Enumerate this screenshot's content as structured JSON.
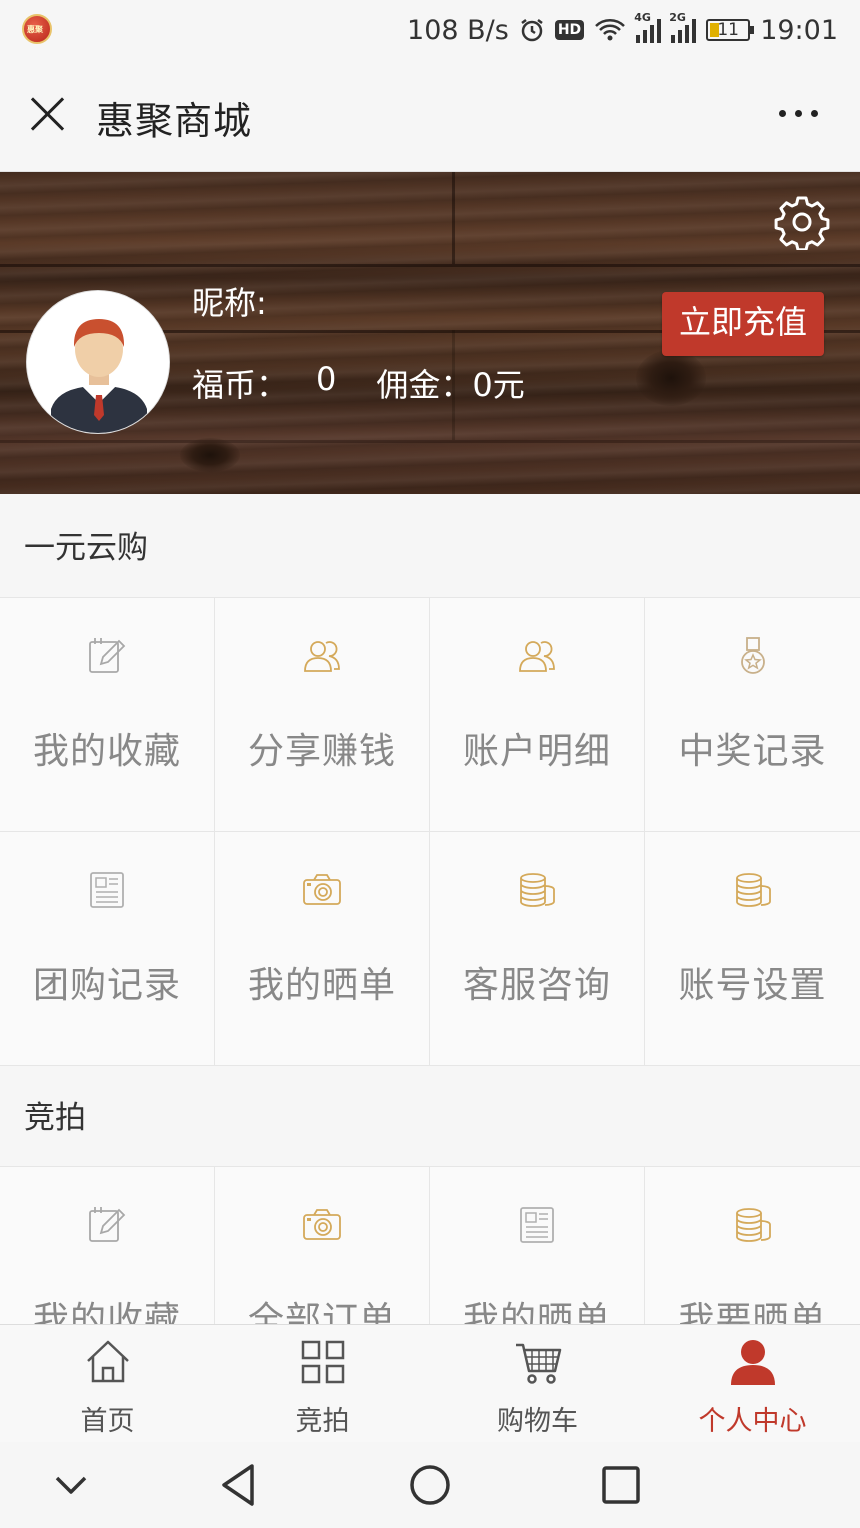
{
  "status_bar": {
    "net_speed": "108 B/s",
    "hd": "HD",
    "signal1": "4G",
    "signal2": "2G",
    "battery": "11",
    "time": "19:01"
  },
  "titlebar": {
    "title": "惠聚商城"
  },
  "profile": {
    "nickname_label": "昵称:",
    "coin_label": "福币：",
    "coin_value": "0",
    "commission_label": "佣金：",
    "commission_value": "0元",
    "recharge_label": "立即充值"
  },
  "sections": [
    {
      "title": "一元云购",
      "items": [
        {
          "label": "我的收藏",
          "icon": "edit-icon"
        },
        {
          "label": "分享赚钱",
          "icon": "users-icon"
        },
        {
          "label": "账户明细",
          "icon": "users-icon"
        },
        {
          "label": "中奖记录",
          "icon": "medal-icon"
        },
        {
          "label": "团购记录",
          "icon": "newspaper-icon"
        },
        {
          "label": "我的晒单",
          "icon": "camera-icon"
        },
        {
          "label": "客服咨询",
          "icon": "coins-icon"
        },
        {
          "label": "账号设置",
          "icon": "coins-icon"
        }
      ]
    },
    {
      "title": "竞拍",
      "items": [
        {
          "label": "我的收藏",
          "icon": "edit-icon"
        },
        {
          "label": "全部订单",
          "icon": "camera-icon"
        },
        {
          "label": "我的晒单",
          "icon": "newspaper-icon"
        },
        {
          "label": "我要晒单",
          "icon": "coins-icon"
        }
      ]
    }
  ],
  "tabbar": [
    {
      "label": "首页",
      "icon": "home-icon",
      "active": false
    },
    {
      "label": "竞拍",
      "icon": "grid-icon",
      "active": false
    },
    {
      "label": "购物车",
      "icon": "cart-icon",
      "active": false
    },
    {
      "label": "个人中心",
      "icon": "person-icon",
      "active": true
    }
  ],
  "colors": {
    "accent": "#c0392b",
    "gold_icon": "#d4a95a",
    "gray_icon": "#a8a8a8"
  }
}
